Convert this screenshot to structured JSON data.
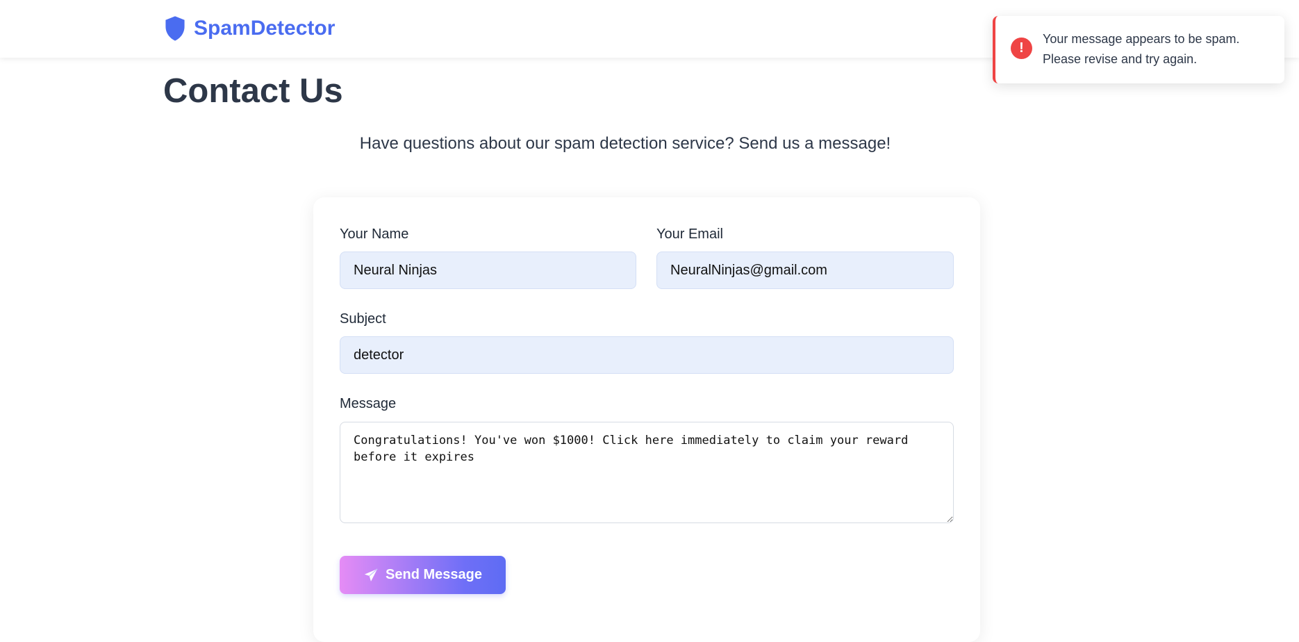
{
  "navbar": {
    "brand": "SpamDetector",
    "brand_icon": "shield-icon",
    "brand_color": "#4a6cf0"
  },
  "page": {
    "title": "Contact Us",
    "subtitle": "Have questions about our spam detection service? Send us a message!"
  },
  "form": {
    "name_label": "Your Name",
    "name_value": "Neural Ninjas",
    "email_label": "Your Email",
    "email_value": "NeuralNinjas@gmail.com",
    "subject_label": "Subject",
    "subject_value": "detector",
    "message_label": "Message",
    "message_value": "Congratulations! You've won $1000! Click here immediately to claim your reward before it expires",
    "submit_label": "Send Message",
    "submit_icon": "paper-plane-icon"
  },
  "toast": {
    "icon": "exclamation-circle-icon",
    "color": "#ef4444",
    "line1": "Your message appears to be spam.",
    "line2": "Please revise and try again."
  }
}
